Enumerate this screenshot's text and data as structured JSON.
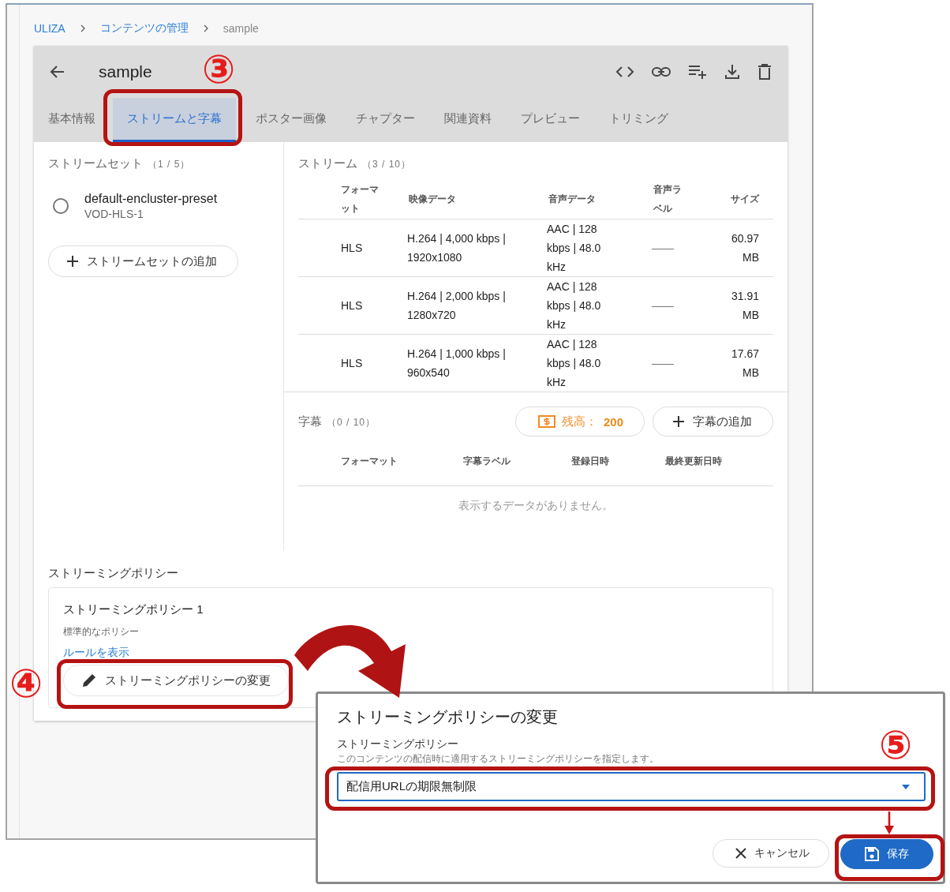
{
  "breadcrumb": [
    {
      "label": "ULIZA",
      "link": true
    },
    {
      "label": "コンテンツの管理",
      "link": true
    },
    {
      "label": "sample",
      "link": false
    }
  ],
  "header": {
    "title": "sample"
  },
  "tabs": [
    {
      "label": "基本情報",
      "selected": false
    },
    {
      "label": "ストリームと字幕",
      "selected": true
    },
    {
      "label": "ポスター画像",
      "selected": false
    },
    {
      "label": "チャプター",
      "selected": false
    },
    {
      "label": "関連資料",
      "selected": false
    },
    {
      "label": "プレビュー",
      "selected": false
    },
    {
      "label": "トリミング",
      "selected": false
    }
  ],
  "stream_sets": {
    "title": "ストリームセット",
    "count": "（1 / 5）",
    "items": [
      {
        "name": "default-encluster-preset",
        "sub": "VOD-HLS-1",
        "selected": false
      }
    ],
    "add_button": "ストリームセットの追加"
  },
  "streams": {
    "title": "ストリーム",
    "count": "（3 / 10）",
    "columns": [
      "フォーマット",
      "映像データ",
      "音声データ",
      "音声ラベル",
      "サイズ"
    ],
    "rows": [
      [
        "HLS",
        "H.264 | 4,000 kbps | 1920x1080",
        "AAC | 128 kbps | 48.0 kHz",
        "——",
        "60.97 MB"
      ],
      [
        "HLS",
        "H.264 | 2,000 kbps | 1280x720",
        "AAC | 128 kbps | 48.0 kHz",
        "——",
        "31.91 MB"
      ],
      [
        "HLS",
        "H.264 | 1,000 kbps | 960x540",
        "AAC | 128 kbps | 48.0 kHz",
        "——",
        "17.67 MB"
      ]
    ]
  },
  "subtitles": {
    "title": "字幕",
    "count": "（0 / 10）",
    "balance_label": "残高：",
    "balance_value": "200",
    "add_button": "字幕の追加",
    "columns": [
      "フォーマット",
      "字幕ラベル",
      "登録日時",
      "最終更新日時"
    ],
    "empty_text": "表示するデータがありません。"
  },
  "streaming_policy": {
    "heading": "ストリーミングポリシー",
    "name": "ストリーミングポリシー 1",
    "description": "標準的なポリシー",
    "rules_link": "ルールを表示",
    "change_button": "ストリーミングポリシーの変更"
  },
  "dialog": {
    "title": "ストリーミングポリシーの変更",
    "field_label": "ストリーミングポリシー",
    "hint": "このコンテンツの配信時に適用するストリーミングポリシーを指定します。",
    "value": "配信用URLの期限無制限",
    "buttons": [
      {
        "label": "キャンセル",
        "kind": "cancel"
      },
      {
        "label": "保存",
        "kind": "save"
      }
    ]
  },
  "annotations": [
    {
      "label": "③",
      "kind": "tab"
    },
    {
      "label": "④",
      "kind": "button"
    },
    {
      "label": "⑤",
      "kind": "select"
    }
  ]
}
